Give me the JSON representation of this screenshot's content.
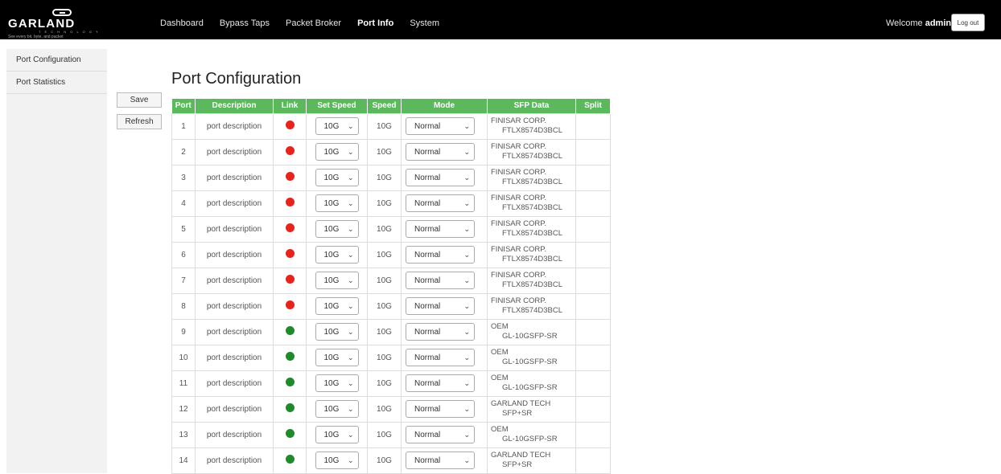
{
  "brand": {
    "name": "GARLAND",
    "sub": "T E C H N O L O G Y",
    "tagline": "See every bit, byte, and packet"
  },
  "nav": {
    "items": [
      {
        "label": "Dashboard"
      },
      {
        "label": "Bypass Taps"
      },
      {
        "label": "Packet Broker"
      },
      {
        "label": "Port Info",
        "active": true
      },
      {
        "label": "System"
      }
    ]
  },
  "user": {
    "welcome": "Welcome",
    "name": "admin",
    "logout": "Log out"
  },
  "sidebar": {
    "items": [
      {
        "label": "Port Configuration"
      },
      {
        "label": "Port Statistics"
      }
    ]
  },
  "actions": {
    "save": "Save",
    "refresh": "Refresh"
  },
  "page": {
    "title": "Port Configuration"
  },
  "table": {
    "headers": [
      "Port",
      "Description",
      "Link",
      "Set Speed",
      "Speed",
      "Mode",
      "SFP Data",
      "Split"
    ],
    "rows": [
      {
        "port": "1",
        "desc": "port description",
        "link": "down",
        "set": "10G",
        "speed": "10G",
        "mode": "Normal",
        "sfp1": "FINISAR CORP.",
        "sfp2": "FTLX8574D3BCL"
      },
      {
        "port": "2",
        "desc": "port description",
        "link": "down",
        "set": "10G",
        "speed": "10G",
        "mode": "Normal",
        "sfp1": "FINISAR CORP.",
        "sfp2": "FTLX8574D3BCL"
      },
      {
        "port": "3",
        "desc": "port description",
        "link": "down",
        "set": "10G",
        "speed": "10G",
        "mode": "Normal",
        "sfp1": "FINISAR CORP.",
        "sfp2": "FTLX8574D3BCL"
      },
      {
        "port": "4",
        "desc": "port description",
        "link": "down",
        "set": "10G",
        "speed": "10G",
        "mode": "Normal",
        "sfp1": "FINISAR CORP.",
        "sfp2": "FTLX8574D3BCL"
      },
      {
        "port": "5",
        "desc": "port description",
        "link": "down",
        "set": "10G",
        "speed": "10G",
        "mode": "Normal",
        "sfp1": "FINISAR CORP.",
        "sfp2": "FTLX8574D3BCL"
      },
      {
        "port": "6",
        "desc": "port description",
        "link": "down",
        "set": "10G",
        "speed": "10G",
        "mode": "Normal",
        "sfp1": "FINISAR CORP.",
        "sfp2": "FTLX8574D3BCL"
      },
      {
        "port": "7",
        "desc": "port description",
        "link": "down",
        "set": "10G",
        "speed": "10G",
        "mode": "Normal",
        "sfp1": "FINISAR CORP.",
        "sfp2": "FTLX8574D3BCL"
      },
      {
        "port": "8",
        "desc": "port description",
        "link": "down",
        "set": "10G",
        "speed": "10G",
        "mode": "Normal",
        "sfp1": "FINISAR CORP.",
        "sfp2": "FTLX8574D3BCL"
      },
      {
        "port": "9",
        "desc": "port description",
        "link": "up",
        "set": "10G",
        "speed": "10G",
        "mode": "Normal",
        "sfp1": "OEM",
        "sfp2": "GL-10GSFP-SR"
      },
      {
        "port": "10",
        "desc": "port description",
        "link": "up",
        "set": "10G",
        "speed": "10G",
        "mode": "Normal",
        "sfp1": "OEM",
        "sfp2": "GL-10GSFP-SR"
      },
      {
        "port": "11",
        "desc": "port description",
        "link": "up",
        "set": "10G",
        "speed": "10G",
        "mode": "Normal",
        "sfp1": "OEM",
        "sfp2": "GL-10GSFP-SR"
      },
      {
        "port": "12",
        "desc": "port description",
        "link": "up",
        "set": "10G",
        "speed": "10G",
        "mode": "Normal",
        "sfp1": "GARLAND TECH",
        "sfp2": "SFP+SR"
      },
      {
        "port": "13",
        "desc": "port description",
        "link": "up",
        "set": "10G",
        "speed": "10G",
        "mode": "Normal",
        "sfp1": "OEM",
        "sfp2": "GL-10GSFP-SR"
      },
      {
        "port": "14",
        "desc": "port description",
        "link": "up",
        "set": "10G",
        "speed": "10G",
        "mode": "Normal",
        "sfp1": "GARLAND TECH",
        "sfp2": "SFP+SR"
      }
    ]
  },
  "colors": {
    "header_green": "#5cb85c",
    "link_down": "#e8231c",
    "link_up": "#1f8a2a",
    "topbar": "#000000"
  }
}
